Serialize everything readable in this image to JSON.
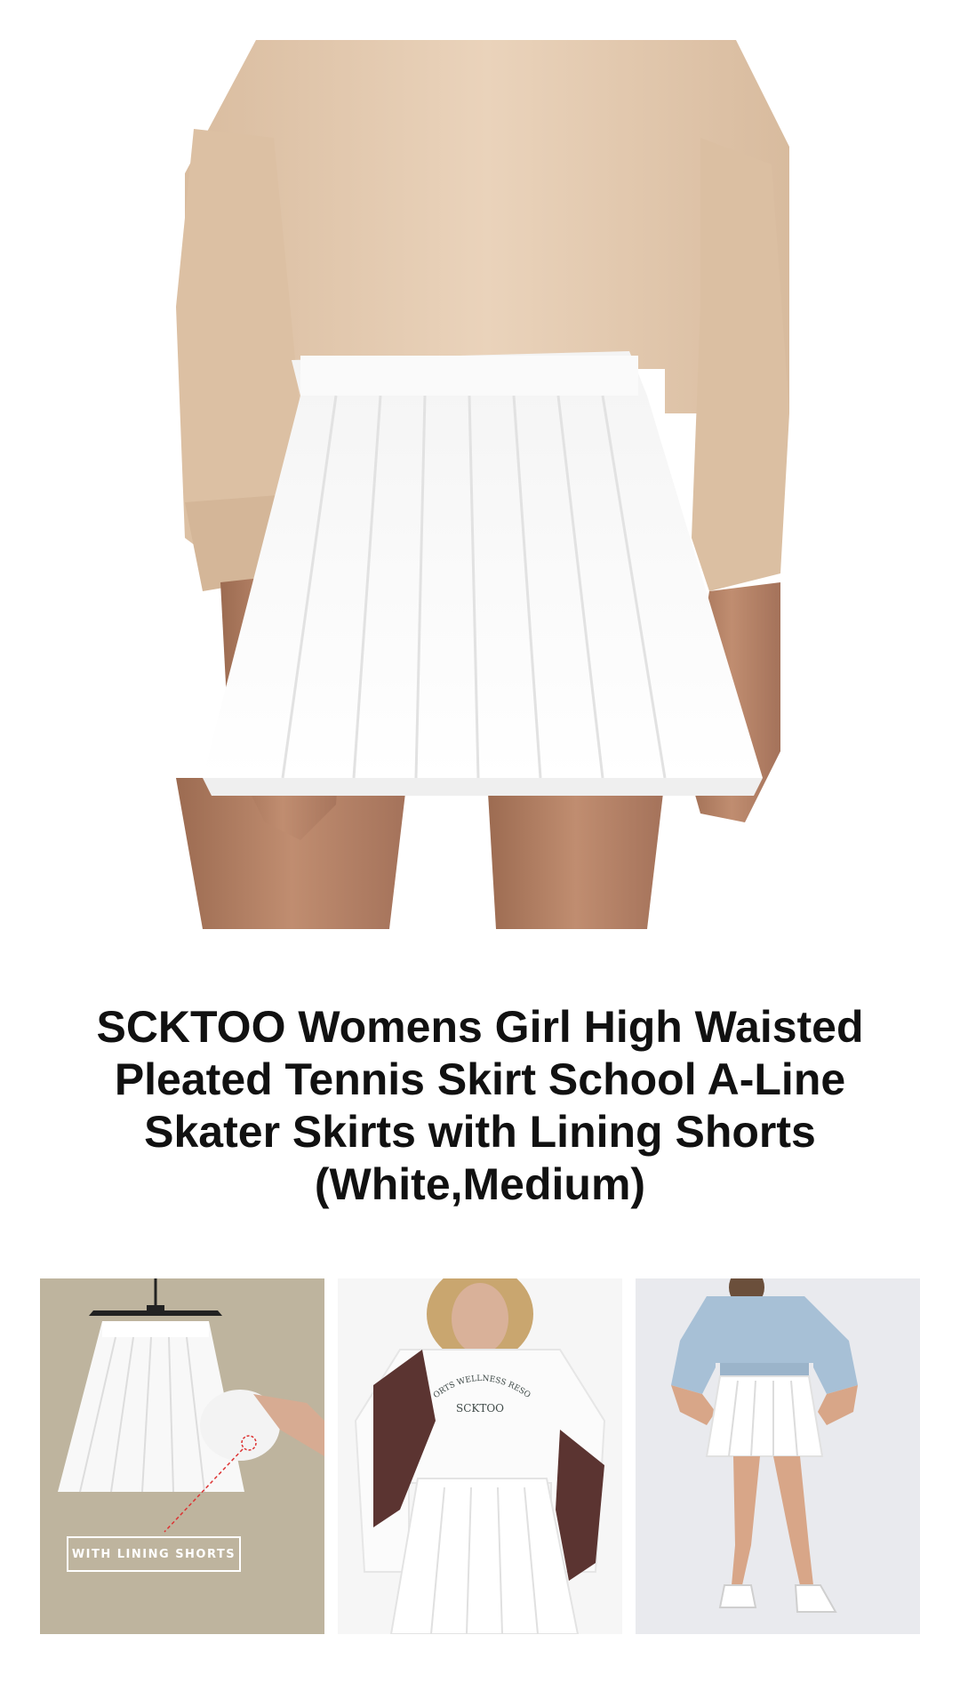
{
  "product": {
    "title": "SCKTOO Womens Girl High Waisted Pleated Tennis Skirt School A-Line Skater Skirts with Lining Shorts (White,Medium)"
  },
  "images": {
    "main": {
      "icon": "product-main-photo"
    },
    "thumbnails": [
      {
        "icon": "skirt-on-hanger-photo",
        "badge": "WITH LINING SHORTS"
      },
      {
        "icon": "model-sweatshirt-photo",
        "shirt_text_top": "SPORTS WELLNESS RESORT",
        "shirt_text_bottom": "SCKTOO"
      },
      {
        "icon": "model-hoodie-photo"
      }
    ]
  },
  "colors": {
    "background": "#ffffff",
    "title_text": "#111111",
    "sweater": "#e7cfb6",
    "skirt": "#ffffff",
    "skin": "#b9876a"
  }
}
